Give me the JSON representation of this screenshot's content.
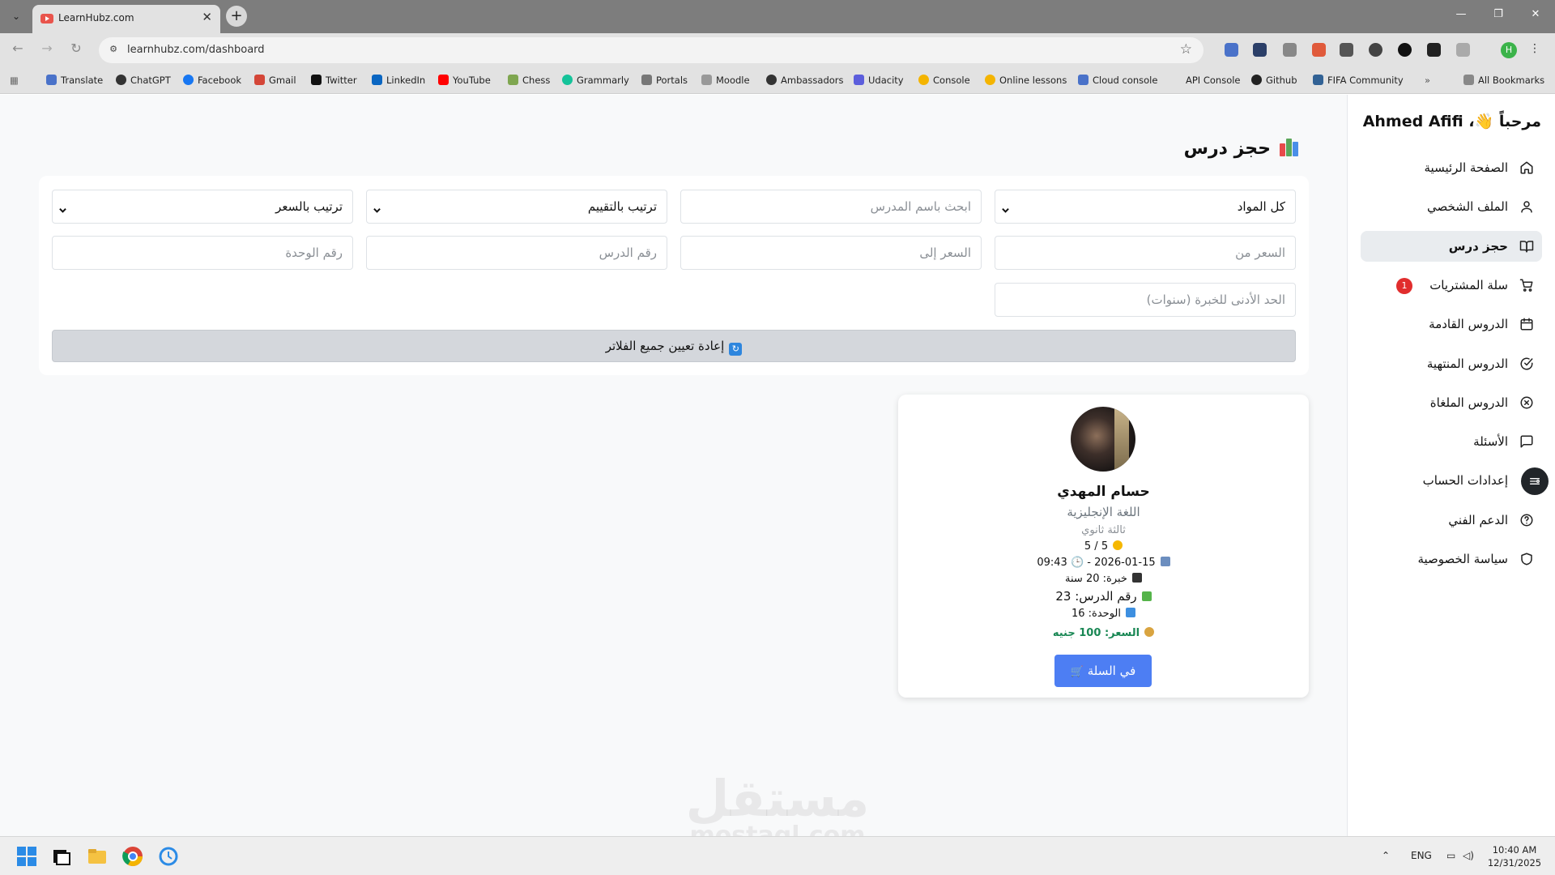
{
  "browser": {
    "tab_title": "LearnHubz.com",
    "url": "learnhubz.com/dashboard",
    "profile_initial": "H",
    "bookmarks": [
      "Translate",
      "ChatGPT",
      "Facebook",
      "Gmail",
      "Twitter",
      "LinkedIn",
      "YouTube",
      "Chess",
      "Grammarly",
      "Portals",
      "Moodle",
      "Ambassadors",
      "Udacity",
      "Console",
      "Online lessons",
      "Cloud console",
      "API Console",
      "Github",
      "FIFA Community"
    ],
    "all_bookmarks": "All Bookmarks"
  },
  "sidebar": {
    "greeting": "مرحباً 👋، Ahmed Afifi",
    "items": [
      {
        "label": "الصفحة الرئيسية",
        "icon": "home-icon"
      },
      {
        "label": "الملف الشخصي",
        "icon": "user-icon"
      },
      {
        "label": "حجز درس",
        "icon": "book-open-icon",
        "active": true
      },
      {
        "label": "سلة المشتريات",
        "icon": "cart-icon",
        "badge": "1"
      },
      {
        "label": "الدروس القادمة",
        "icon": "calendar-icon"
      },
      {
        "label": "الدروس المنتهية",
        "icon": "check-circle-icon"
      },
      {
        "label": "الدروس الملغاة",
        "icon": "x-circle-icon"
      },
      {
        "label": "الأسئلة",
        "icon": "message-square-icon"
      },
      {
        "label": "إعدادات الحساب",
        "icon": "settings-icon"
      },
      {
        "label": "الدعم الفني",
        "icon": "help-circle-icon"
      },
      {
        "label": "سياسة الخصوصية",
        "icon": "shield-icon"
      }
    ]
  },
  "main": {
    "title": "حجز درس",
    "filters": {
      "subject_select": "كل المواد",
      "teacher_search_placeholder": "ابحث باسم المدرس",
      "sort_rating": "ترتيب بالتقييم",
      "sort_price": "ترتيب بالسعر",
      "price_from_placeholder": "السعر من",
      "price_to_placeholder": "السعر إلى",
      "lesson_number_placeholder": "رقم الدرس",
      "unit_number_placeholder": "رقم الوحدة",
      "min_experience_placeholder": "الحد الأدنى للخبرة (سنوات)",
      "reset_label": "إعادة تعيين جميع الفلاتر"
    },
    "teacher_card": {
      "name": "حسام المهدي",
      "subject": "اللغة الإنجليزية",
      "grade": "ثالثة ثانوي",
      "rating": "5 / 5",
      "datetime": "2026-01-15 - 🕒 09:43",
      "experience": "خبرة: 20 سنة",
      "lesson_number": "رقم الدرس: 23",
      "unit": "الوحدة: 16",
      "price_label": "السعر:",
      "price_value": "100 جنيه",
      "cart_button": "في السلة"
    }
  },
  "watermark": {
    "arabic": "مستقل",
    "latin": "mostaql.com"
  },
  "taskbar": {
    "language": "ENG",
    "time": "10:40 AM",
    "date": "12/31/2025"
  }
}
